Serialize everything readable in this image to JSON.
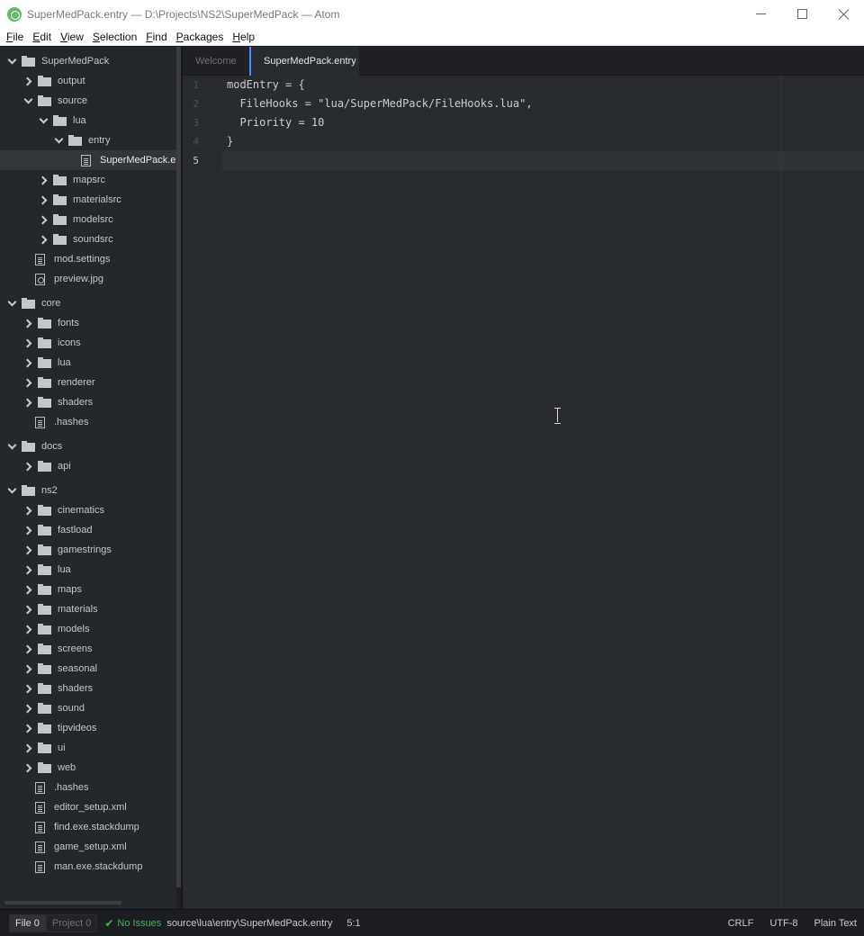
{
  "window": {
    "title": "SuperMedPack.entry — D:\\Projects\\NS2\\SuperMedPack — Atom"
  },
  "menu": [
    {
      "u": "F",
      "rest": "ile"
    },
    {
      "u": "E",
      "rest": "dit"
    },
    {
      "u": "V",
      "rest": "iew"
    },
    {
      "u": "S",
      "rest": "election"
    },
    {
      "u": "F",
      "rest": "ind"
    },
    {
      "u": "P",
      "rest": "ackages"
    },
    {
      "u": "H",
      "rest": "elp"
    }
  ],
  "tree": [
    {
      "label": "SuperMedPack",
      "type": "folder",
      "level": 0,
      "expanded": true
    },
    {
      "label": "output",
      "type": "folder",
      "level": 1,
      "expanded": false
    },
    {
      "label": "source",
      "type": "folder",
      "level": 1,
      "expanded": true
    },
    {
      "label": "lua",
      "type": "folder",
      "level": 2,
      "expanded": true
    },
    {
      "label": "entry",
      "type": "folder",
      "level": 3,
      "expanded": true
    },
    {
      "label": "SuperMedPack.entry",
      "type": "file",
      "level": 4,
      "selected": true
    },
    {
      "label": "mapsrc",
      "type": "folder",
      "level": 2,
      "expanded": false
    },
    {
      "label": "materialsrc",
      "type": "folder",
      "level": 2,
      "expanded": false
    },
    {
      "label": "modelsrc",
      "type": "folder",
      "level": 2,
      "expanded": false
    },
    {
      "label": "soundsrc",
      "type": "folder",
      "level": 2,
      "expanded": false
    },
    {
      "label": "mod.settings",
      "type": "file",
      "level": 1
    },
    {
      "label": "preview.jpg",
      "type": "media",
      "level": 1
    },
    {
      "label": "core",
      "type": "folder",
      "level": 0,
      "expanded": true
    },
    {
      "label": "fonts",
      "type": "folder",
      "level": 1,
      "expanded": false
    },
    {
      "label": "icons",
      "type": "folder",
      "level": 1,
      "expanded": false
    },
    {
      "label": "lua",
      "type": "folder",
      "level": 1,
      "expanded": false
    },
    {
      "label": "renderer",
      "type": "folder",
      "level": 1,
      "expanded": false
    },
    {
      "label": "shaders",
      "type": "folder",
      "level": 1,
      "expanded": false
    },
    {
      "label": ".hashes",
      "type": "file",
      "level": 1
    },
    {
      "label": "docs",
      "type": "folder",
      "level": 0,
      "expanded": true
    },
    {
      "label": "api",
      "type": "folder",
      "level": 1,
      "expanded": false
    },
    {
      "label": "ns2",
      "type": "folder",
      "level": 0,
      "expanded": true
    },
    {
      "label": "cinematics",
      "type": "folder",
      "level": 1,
      "expanded": false
    },
    {
      "label": "fastload",
      "type": "folder",
      "level": 1,
      "expanded": false
    },
    {
      "label": "gamestrings",
      "type": "folder",
      "level": 1,
      "expanded": false
    },
    {
      "label": "lua",
      "type": "folder",
      "level": 1,
      "expanded": false
    },
    {
      "label": "maps",
      "type": "folder",
      "level": 1,
      "expanded": false
    },
    {
      "label": "materials",
      "type": "folder",
      "level": 1,
      "expanded": false
    },
    {
      "label": "models",
      "type": "folder",
      "level": 1,
      "expanded": false
    },
    {
      "label": "screens",
      "type": "folder",
      "level": 1,
      "expanded": false
    },
    {
      "label": "seasonal",
      "type": "folder",
      "level": 1,
      "expanded": false
    },
    {
      "label": "shaders",
      "type": "folder",
      "level": 1,
      "expanded": false
    },
    {
      "label": "sound",
      "type": "folder",
      "level": 1,
      "expanded": false
    },
    {
      "label": "tipvideos",
      "type": "folder",
      "level": 1,
      "expanded": false
    },
    {
      "label": "ui",
      "type": "folder",
      "level": 1,
      "expanded": false
    },
    {
      "label": "web",
      "type": "folder",
      "level": 1,
      "expanded": false
    },
    {
      "label": ".hashes",
      "type": "file",
      "level": 1
    },
    {
      "label": "editor_setup.xml",
      "type": "file",
      "level": 1
    },
    {
      "label": "find.exe.stackdump",
      "type": "file",
      "level": 1
    },
    {
      "label": "game_setup.xml",
      "type": "file",
      "level": 1
    },
    {
      "label": "man.exe.stackdump",
      "type": "file",
      "level": 1
    }
  ],
  "tabs": {
    "inactive": "Welcome",
    "active": "SuperMedPack.entry"
  },
  "editor": {
    "line_numbers": [
      "1",
      "2",
      "3",
      "4",
      "5"
    ],
    "lines": [
      "modEntry = {",
      "  FileHooks = \"lua/SuperMedPack/FileHooks.lua\",",
      "  Priority = 10",
      "}",
      ""
    ],
    "current_line": 5
  },
  "status": {
    "file_label": "File 0",
    "project_label": "Project 0",
    "issues": "No Issues",
    "path": "source\\lua\\entry\\SuperMedPack.entry",
    "cursor_pos": "5:1",
    "line_ending": "CRLF",
    "encoding": "UTF-8",
    "grammar": "Plain Text"
  },
  "colors": {
    "accent": "#528bff",
    "ok": "#45b35a"
  }
}
